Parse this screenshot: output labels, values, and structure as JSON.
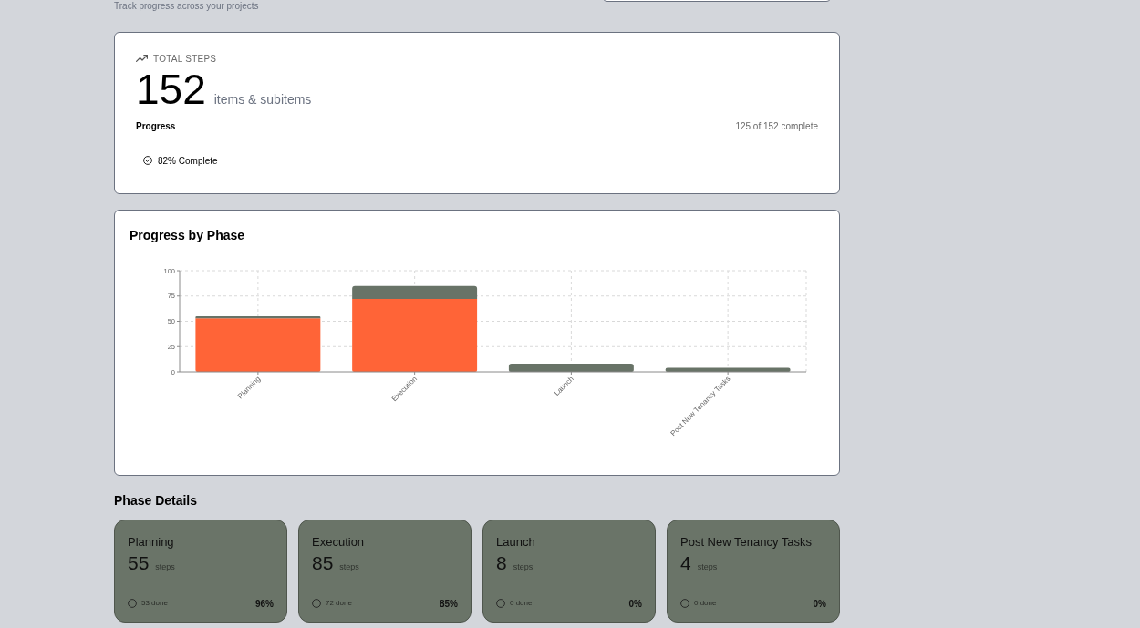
{
  "header": {
    "subtitle": "Track progress across your projects"
  },
  "summary": {
    "label": "TOTAL STEPS",
    "total": "152",
    "unit": "items & subitems",
    "progress_label": "Progress",
    "progress_count": "125 of 152 complete",
    "complete_badge": "82% Complete"
  },
  "chart_card": {
    "title": "Progress by Phase",
    "chart_data": {
      "type": "bar",
      "stacked": true,
      "grid": true,
      "categories": [
        "Planning",
        "Execution",
        "Launch",
        "Post New Tenancy Tasks"
      ],
      "series": [
        {
          "color": "#ff6437",
          "values": [
            53,
            72,
            0,
            0
          ]
        },
        {
          "color": "#687367",
          "values": [
            2,
            13,
            8,
            4
          ]
        }
      ],
      "ylim": [
        0,
        100
      ],
      "yticks": [
        0,
        25,
        50,
        75,
        100
      ]
    }
  },
  "phase_details": {
    "title": "Phase Details",
    "phases": [
      {
        "name": "Planning",
        "count": "55",
        "unit": "steps",
        "done": "53 done",
        "percent": "96%"
      },
      {
        "name": "Execution",
        "count": "85",
        "unit": "steps",
        "done": "72 done",
        "percent": "85%"
      },
      {
        "name": "Launch",
        "count": "8",
        "unit": "steps",
        "done": "0 done",
        "percent": "0%"
      },
      {
        "name": "Post New Tenancy Tasks",
        "count": "4",
        "unit": "steps",
        "done": "0 done",
        "percent": "0%"
      }
    ]
  }
}
